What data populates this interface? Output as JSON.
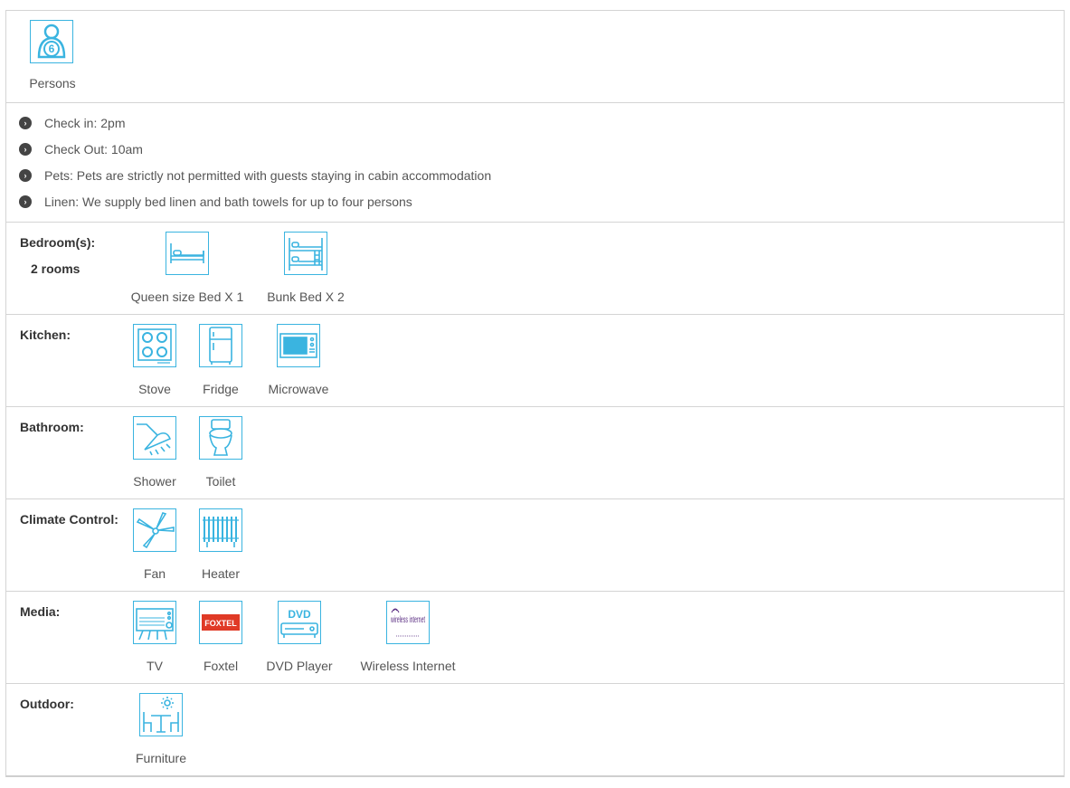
{
  "persons": {
    "count": "6",
    "label": "Persons",
    "icon": "person-icon"
  },
  "rules": [
    "Check in: 2pm",
    "Check Out: 10am",
    "Pets: Pets are strictly not permitted with guests staying in cabin accommodation",
    "Linen: We supply bed linen and bath towels for up to four persons"
  ],
  "bedrooms": {
    "label": "Bedroom(s):",
    "rooms": "2 rooms",
    "items": [
      {
        "label": "Queen size Bed X 1",
        "icon": "queen-bed-icon"
      },
      {
        "label": "Bunk Bed X 2",
        "icon": "bunk-bed-icon"
      }
    ]
  },
  "kitchen": {
    "label": "Kitchen:",
    "items": [
      {
        "label": "Stove",
        "icon": "stove-icon"
      },
      {
        "label": "Fridge",
        "icon": "fridge-icon"
      },
      {
        "label": "Microwave",
        "icon": "microwave-icon"
      }
    ]
  },
  "bathroom": {
    "label": "Bathroom:",
    "items": [
      {
        "label": "Shower",
        "icon": "shower-icon"
      },
      {
        "label": "Toilet",
        "icon": "toilet-icon"
      }
    ]
  },
  "climate": {
    "label": "Climate Control:",
    "items": [
      {
        "label": "Fan",
        "icon": "fan-icon"
      },
      {
        "label": "Heater",
        "icon": "heater-icon"
      }
    ]
  },
  "media": {
    "label": "Media:",
    "items": [
      {
        "label": "TV",
        "icon": "tv-icon"
      },
      {
        "label": "Foxtel",
        "icon": "foxtel-icon",
        "logo_text": "FOXTEL"
      },
      {
        "label": "DVD Player",
        "icon": "dvd-player-icon",
        "logo_text": "DVD"
      },
      {
        "label": "Wireless Internet",
        "icon": "wireless-internet-icon",
        "logo_text": "wireless internet"
      }
    ]
  },
  "outdoor": {
    "label": "Outdoor:",
    "items": [
      {
        "label": "Furniture",
        "icon": "outdoor-furniture-icon"
      }
    ]
  },
  "colors": {
    "icon_blue": "#3ab4e0",
    "border": "#d4d4d4",
    "foxtel_red": "#e03a26",
    "text": "#555555"
  }
}
